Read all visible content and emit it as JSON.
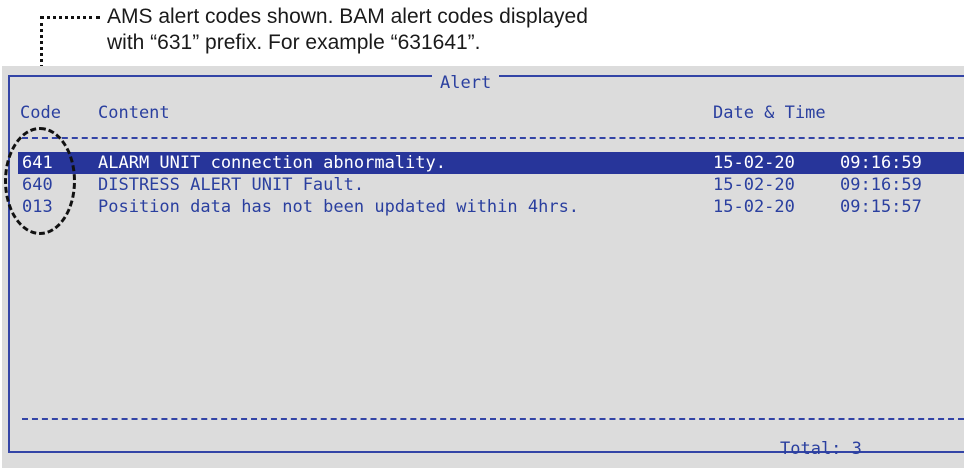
{
  "annotation": {
    "line1": "AMS alert codes shown. BAM alert codes displayed",
    "line2": "with “631” prefix. For example “631641”."
  },
  "window": {
    "title": "Alert"
  },
  "columns": {
    "code": "Code",
    "content": "Content",
    "date_time": "Date & Time"
  },
  "alerts": [
    {
      "code": "641",
      "content": "ALARM UNIT connection abnormality.",
      "date": "15-02-20",
      "time": "09:16:59",
      "selected": true
    },
    {
      "code": "640",
      "content": "DISTRESS ALERT UNIT Fault.",
      "date": "15-02-20",
      "time": "09:16:59",
      "selected": false
    },
    {
      "code": "013",
      "content": "Position data has not been updated within 4hrs.",
      "date": "15-02-20",
      "time": "09:15:57",
      "selected": false
    }
  ],
  "footer": {
    "total": "Total: 3"
  },
  "colors": {
    "screen_bg": "#dcdcdc",
    "text": "#2a3f9f",
    "selection_bg": "#27359a",
    "selection_text": "#ffffff"
  }
}
